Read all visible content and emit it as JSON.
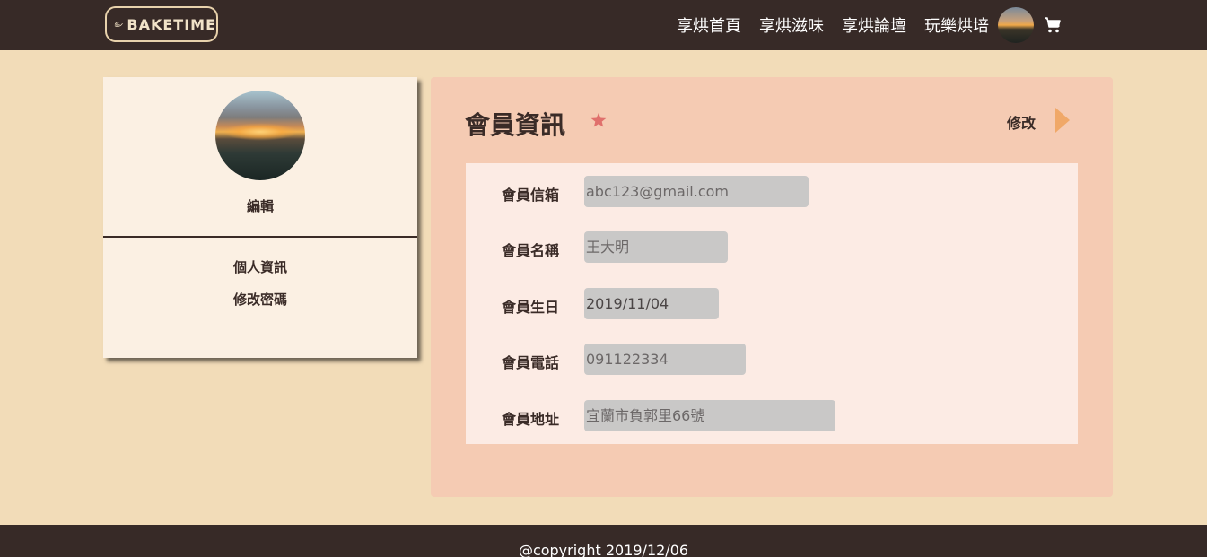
{
  "header": {
    "logo_text": "BAKETIME",
    "nav": [
      "享烘首頁",
      "享烘滋味",
      "享烘論壇",
      "玩樂烘培"
    ]
  },
  "sidebar": {
    "edit_label": "編輯",
    "menu": [
      "個人資訊",
      "修改密碼"
    ]
  },
  "main": {
    "title": "會員資訊",
    "modify_label": "修改",
    "fields": [
      {
        "label": "會員信箱",
        "value": "abc123@gmail.com"
      },
      {
        "label": "會員名稱",
        "value": "王大明"
      },
      {
        "label": "會員生日",
        "value": "2019/11/04"
      },
      {
        "label": "會員電話",
        "value": "091122334"
      },
      {
        "label": "會員地址",
        "value": "宜蘭市負郭里66號"
      }
    ]
  },
  "footer": {
    "copyright": "@copyright 2019/12/06"
  },
  "colors": {
    "header_bg": "#372a27",
    "page_bg": "#f2dcb8",
    "panel_bg": "#f5cbb3",
    "accent_arrow": "#f0a868",
    "star": "#e0706c"
  },
  "icons": {
    "logo": "hand-leaf-icon",
    "cart": "shopping-cart-icon",
    "title_mark": "star-icon",
    "modify": "arrow-right-icon"
  }
}
